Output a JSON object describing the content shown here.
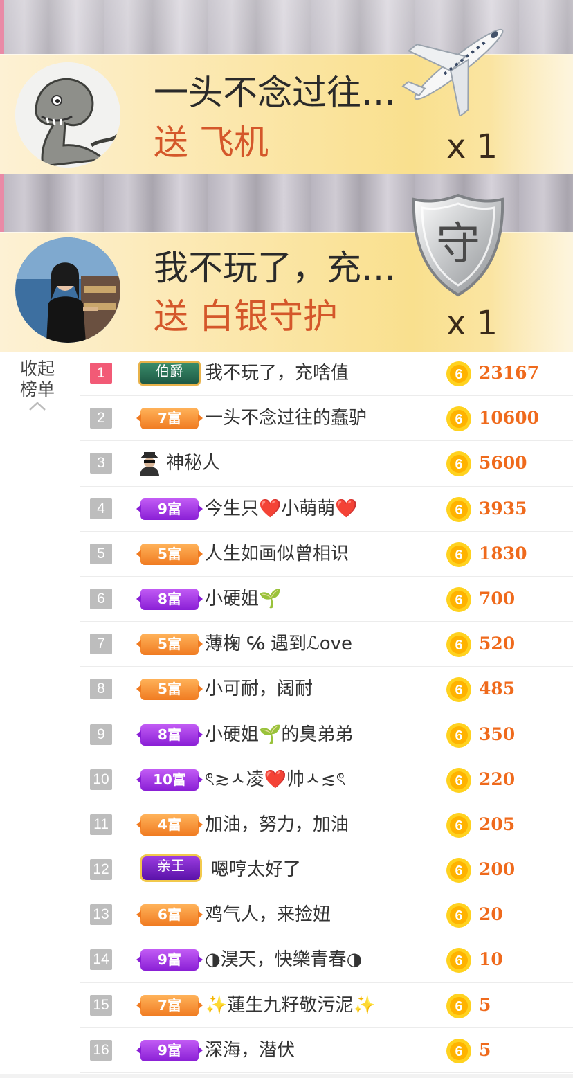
{
  "gift_banners": [
    {
      "sender": "一头不念过往…",
      "action_word": "送",
      "gift_name": "飞机",
      "count": "x 1",
      "gift_icon": "airplane-icon",
      "avatar": "dinosaur-cartoon-avatar"
    },
    {
      "sender": "我不玩了，充…",
      "action_word": "送",
      "gift_name": "白银守护",
      "count": "x 1",
      "gift_icon": "silver-guard-shield-icon",
      "gift_icon_text": "守",
      "avatar": "woman-photo-avatar"
    }
  ],
  "collapse_toggle": {
    "label": "收起榜单",
    "icon": "chevron-up-icon"
  },
  "leaderboard": {
    "coin_icon_text": "6",
    "rows": [
      {
        "rank": "1",
        "badge_type": "earl",
        "badge": "伯爵",
        "name": "我不玩了，充啥值",
        "amount": "23167"
      },
      {
        "rank": "2",
        "badge_type": "orange",
        "badge": "7富",
        "name": "一头不念过往的蠢驴",
        "amount": "10600"
      },
      {
        "rank": "3",
        "badge_type": "mystery",
        "badge": "",
        "name": "神秘人",
        "amount": "5600"
      },
      {
        "rank": "4",
        "badge_type": "purple",
        "badge": "9富",
        "name": "今生只❤️小萌萌❤️",
        "amount": "3935"
      },
      {
        "rank": "5",
        "badge_type": "orange",
        "badge": "5富",
        "name": "人生如画似曾相识",
        "amount": "1830"
      },
      {
        "rank": "6",
        "badge_type": "purple",
        "badge": "8富",
        "name": "小硬姐🌱",
        "amount": "700"
      },
      {
        "rank": "7",
        "badge_type": "orange",
        "badge": "5富",
        "name": "薄椈 ℅ 遇到ℒove",
        "amount": "520"
      },
      {
        "rank": "8",
        "badge_type": "orange",
        "badge": "5富",
        "name": "小可耐，阔耐",
        "amount": "485"
      },
      {
        "rank": "9",
        "badge_type": "purple",
        "badge": "8富",
        "name": "小硬姐🌱的臭弟弟",
        "amount": "350"
      },
      {
        "rank": "10",
        "badge_type": "purple",
        "badge": "10富",
        "name": "ৎ≳ㅅ凌❤️帅ㅅ≲ৎ",
        "amount": "220"
      },
      {
        "rank": "11",
        "badge_type": "orange",
        "badge": "4富",
        "name": "加油，努力，加油",
        "amount": "205"
      },
      {
        "rank": "12",
        "badge_type": "prince",
        "badge": "亲王",
        "name": "嗯哼太好了",
        "amount": "200"
      },
      {
        "rank": "13",
        "badge_type": "orange",
        "badge": "6富",
        "name": "鸡气人，来捡妞",
        "amount": "20"
      },
      {
        "rank": "14",
        "badge_type": "purple",
        "badge": "9富",
        "name": "◑淏天，快樂青春◑",
        "amount": "10"
      },
      {
        "rank": "15",
        "badge_type": "orange",
        "badge": "7富",
        "name": "✨蓮生九籽敬污泥✨",
        "amount": "5"
      },
      {
        "rank": "16",
        "badge_type": "purple",
        "badge": "9富",
        "name": "深海，潜伏",
        "amount": "5"
      }
    ]
  },
  "colors": {
    "accent_orange": "#ef6a1c",
    "gift_text": "#d4572a",
    "first_rank": "#f25a76",
    "rank_default": "#bdbdbd"
  }
}
